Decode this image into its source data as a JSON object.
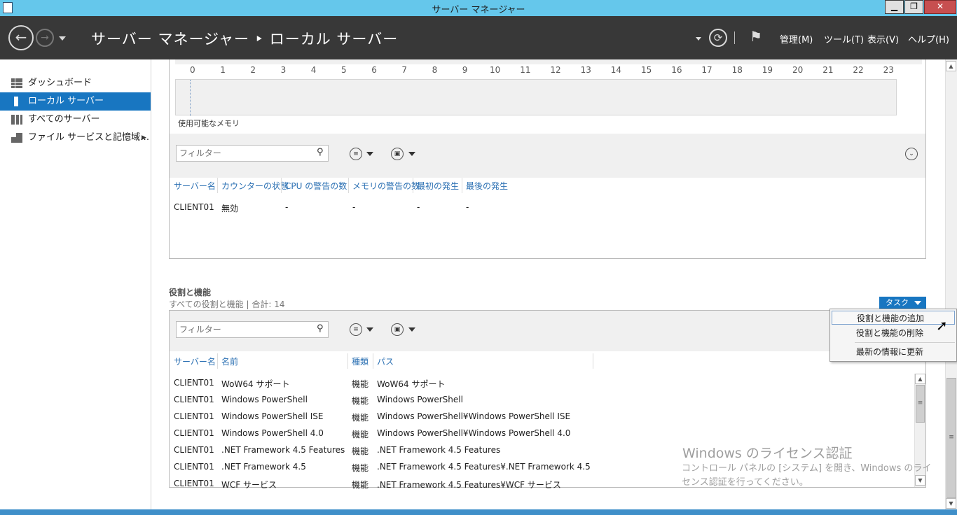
{
  "window": {
    "title": "サーバー マネージャー",
    "minimize": "▁",
    "maximize": "❐",
    "close": "✕"
  },
  "header": {
    "breadcrumb": "サーバー マネージャー ‣ ローカル サーバー",
    "menus": [
      "管理(M)",
      "ツール(T)",
      "表示(V)",
      "ヘルプ(H)"
    ]
  },
  "sidebar": {
    "items": [
      {
        "label": "ダッシュボード",
        "icon": "dashboard-icon"
      },
      {
        "label": "ローカル サーバー",
        "icon": "server-icon",
        "selected": true
      },
      {
        "label": "すべてのサーバー",
        "icon": "servers-icon"
      },
      {
        "label": "ファイル サービスと記憶域…",
        "icon": "file-services-icon"
      }
    ]
  },
  "performance": {
    "hours": [
      "0",
      "1",
      "2",
      "3",
      "4",
      "5",
      "6",
      "7",
      "8",
      "9",
      "10",
      "11",
      "12",
      "13",
      "14",
      "15",
      "16",
      "17",
      "18",
      "19",
      "20",
      "21",
      "22",
      "23"
    ],
    "memory_label": "使用可能なメモリ",
    "filter_placeholder": "フィルター",
    "columns": [
      "サーバー名",
      "カウンターの状態",
      "CPU の警告の数",
      "メモリの警告の数",
      "最初の発生",
      "最後の発生"
    ],
    "rows": [
      [
        "CLIENT01",
        "無効",
        "-",
        "-",
        "-",
        "-"
      ]
    ]
  },
  "roles": {
    "title": "役割と機能",
    "subtitle": "すべての役割と機能 | 合計: 14",
    "tasks_label": "タスク",
    "filter_placeholder": "フィルター",
    "columns": [
      "サーバー名",
      "名前",
      "種類",
      "パス"
    ],
    "rows": [
      [
        "CLIENT01",
        "WoW64 サポート",
        "機能",
        "WoW64 サポート"
      ],
      [
        "CLIENT01",
        "Windows PowerShell",
        "機能",
        "Windows PowerShell"
      ],
      [
        "CLIENT01",
        "Windows PowerShell ISE",
        "機能",
        "Windows PowerShell¥Windows PowerShell ISE"
      ],
      [
        "CLIENT01",
        "Windows PowerShell 4.0",
        "機能",
        "Windows PowerShell¥Windows PowerShell 4.0"
      ],
      [
        "CLIENT01",
        ".NET Framework 4.5 Features",
        "機能",
        ".NET Framework 4.5 Features"
      ],
      [
        "CLIENT01",
        ".NET Framework 4.5",
        "機能",
        ".NET Framework 4.5 Features¥.NET Framework 4.5"
      ],
      [
        "CLIENT01",
        "WCF サービス",
        "機能",
        ".NET Framework 4.5 Features¥WCF サービス"
      ]
    ]
  },
  "context_menu": {
    "items": [
      "役割と機能の追加",
      "役割と機能の削除",
      "最新の情報に更新"
    ]
  },
  "watermark": {
    "title": "Windows のライセンス認証",
    "line1": "コントロール パネルの [システム] を開き、Windows のライ",
    "line2": "センス認証を行ってください。"
  }
}
